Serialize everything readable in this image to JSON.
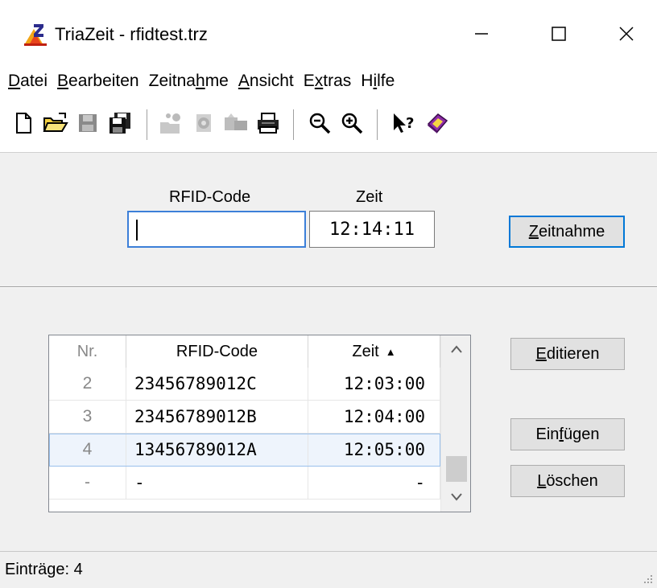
{
  "window": {
    "title": "TriaZeit  -  rfidtest.trz",
    "controls": {
      "minimize": "—",
      "maximize": "☐",
      "close": "✕"
    }
  },
  "menu": [
    {
      "pre": "",
      "ul": "D",
      "post": "atei"
    },
    {
      "pre": "",
      "ul": "B",
      "post": "earbeiten"
    },
    {
      "pre": "Zeitna",
      "ul": "h",
      "post": "me"
    },
    {
      "pre": "",
      "ul": "A",
      "post": "nsicht"
    },
    {
      "pre": "E",
      "ul": "x",
      "post": "tras"
    },
    {
      "pre": "H",
      "ul": "i",
      "post": "lfe"
    }
  ],
  "toolbar": {
    "icons": [
      "new-file-icon",
      "open-folder-icon",
      "save-icon",
      "save-all-icon",
      "import-icon",
      "export-icon",
      "transfer-icon",
      "print-icon",
      "zoom-out-icon",
      "zoom-in-icon",
      "context-help-icon",
      "manual-book-icon"
    ]
  },
  "entry": {
    "rfid_label": "RFID-Code",
    "zeit_label": "Zeit",
    "rfid_value": "",
    "zeit_value": "12:14:11",
    "zeitnahme_pre": "",
    "zeitnahme_ul": "Z",
    "zeitnahme_post": "eitnahme"
  },
  "grid": {
    "columns": [
      "Nr.",
      "RFID-Code",
      "Zeit"
    ],
    "sort_indicator": "▲",
    "rows": [
      {
        "nr": "2",
        "code": "23456789012C",
        "zeit": "12:03:00",
        "selected": false
      },
      {
        "nr": "3",
        "code": "23456789012B",
        "zeit": "12:04:00",
        "selected": false
      },
      {
        "nr": "4",
        "code": "13456789012A",
        "zeit": "12:05:00",
        "selected": true
      },
      {
        "nr": "-",
        "code": "-",
        "zeit": "-",
        "selected": false
      }
    ]
  },
  "actions": {
    "editieren": {
      "pre": "",
      "ul": "E",
      "post": "ditieren"
    },
    "einfuegen": {
      "pre": "Ein",
      "ul": "f",
      "post": "ügen"
    },
    "loeschen": {
      "pre": "",
      "ul": "L",
      "post": "öschen"
    }
  },
  "status": {
    "text": "Einträge: 4"
  },
  "colors": {
    "accent": "#0078d7",
    "selection": "#eef4fc",
    "client_bg": "#f0f0f0"
  }
}
